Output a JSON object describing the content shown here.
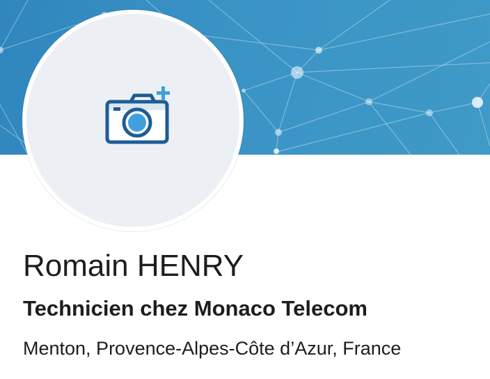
{
  "profile": {
    "name": "Romain HENRY",
    "headline": "Technicien chez Monaco Telecom",
    "location": "Menton, Provence-Alpes-Côte d’Azur, France"
  },
  "icons": {
    "avatar_placeholder": "camera-add-icon",
    "banner_pattern": "network-pattern"
  },
  "colors": {
    "banner": "#3a93c5",
    "avatar_bg": "#ecf0f5",
    "camera_outline": "#1e5c96",
    "camera_lens": "#3fa0dd",
    "plus": "#3fa0dd",
    "text": "#1d1d1d"
  }
}
